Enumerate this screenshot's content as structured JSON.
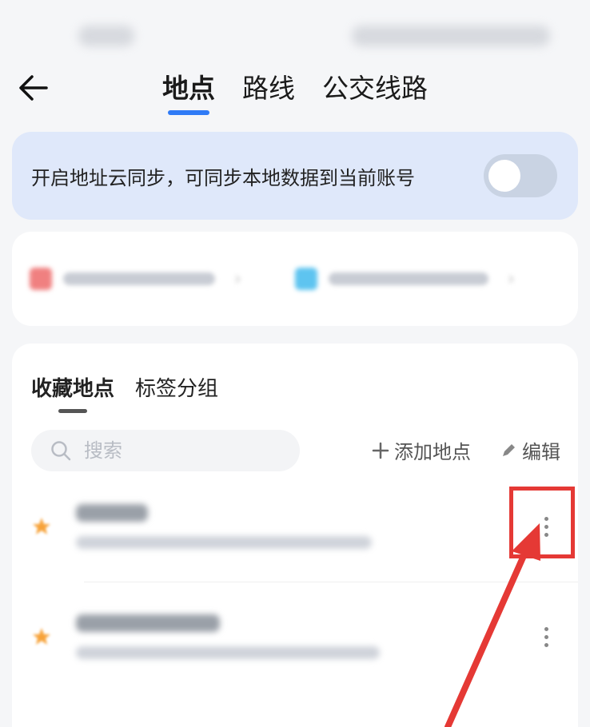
{
  "header": {
    "tabs": [
      {
        "label": "地点",
        "active": true
      },
      {
        "label": "路线",
        "active": false
      },
      {
        "label": "公交线路",
        "active": false
      }
    ]
  },
  "sync_banner": {
    "text": "开启地址云同步，可同步本地数据到当前账号",
    "toggle_on": false
  },
  "main": {
    "subtabs": [
      {
        "label": "收藏地点",
        "active": true
      },
      {
        "label": "标签分组",
        "active": false
      }
    ],
    "search": {
      "placeholder": "搜索"
    },
    "add_label": "添加地点",
    "edit_label": "编辑"
  },
  "colors": {
    "accent": "#2f7bf6",
    "banner_bg": "#dfe8fa",
    "star": "#f7a33a",
    "home_icon": "#f08080",
    "work_icon": "#5ec4f0",
    "highlight": "#e53935"
  },
  "icons": [
    "back-arrow-icon",
    "search-icon",
    "plus-icon",
    "pencil-icon",
    "star-icon",
    "more-vertical-icon"
  ]
}
